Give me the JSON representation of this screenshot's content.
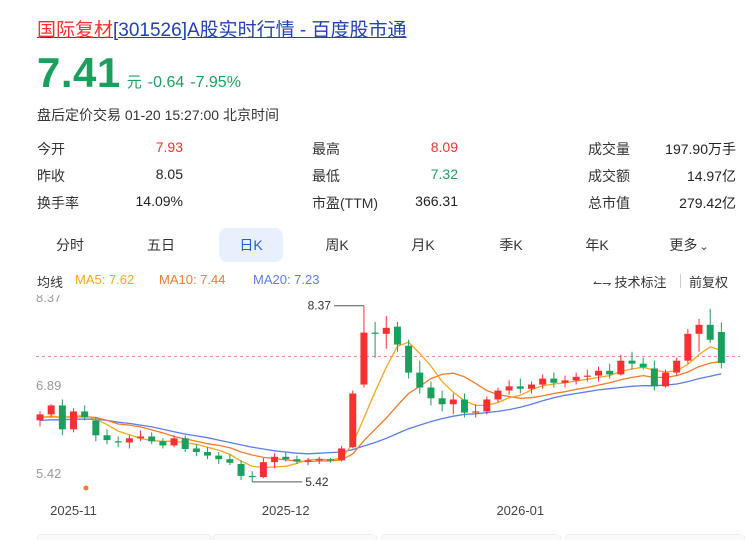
{
  "header": {
    "title_highlight": "国际复材",
    "title_rest": "[301526]A股实时行情 - 百度股市通"
  },
  "quote": {
    "price": "7.41",
    "unit": "元",
    "change": "-0.64",
    "change_pct": "-7.95%",
    "status_time": "盘后定价交易 01-20 15:27:00 北京时间"
  },
  "metrics": {
    "open_label": "今开",
    "open": "7.93",
    "prev_close_label": "昨收",
    "prev_close": "8.05",
    "turnover_label": "换手率",
    "turnover": "14.09%",
    "high_label": "最高",
    "high": "8.09",
    "low_label": "最低",
    "low": "7.32",
    "pe_label": "市盈(TTM)",
    "pe": "366.31",
    "volume_label": "成交量",
    "volume": "197.90万手",
    "amount_label": "成交额",
    "amount": "14.97亿",
    "mktcap_label": "总市值",
    "mktcap": "279.42亿"
  },
  "tabs": [
    {
      "label": "分时",
      "active": false
    },
    {
      "label": "五日",
      "active": false
    },
    {
      "label": "日K",
      "active": true
    },
    {
      "label": "周K",
      "active": false
    },
    {
      "label": "月K",
      "active": false
    },
    {
      "label": "季K",
      "active": false
    },
    {
      "label": "年K",
      "active": false
    },
    {
      "label": "更多",
      "active": false
    }
  ],
  "ma_legend": {
    "label": "均线",
    "ma5": "MA5: 7.62",
    "ma10": "MA10: 7.44",
    "ma20": "MA20: 7.23"
  },
  "tools": {
    "indicator": "技术标注",
    "adjust": "前复权"
  },
  "colors": {
    "up": "#f73131",
    "down": "#1a9f5c",
    "ma5": "#f5a623",
    "ma10": "#f07b2c",
    "ma20": "#5b7ee5",
    "active_tab_bg": "#e8f0fe",
    "active_tab_text": "#2a5bd7"
  },
  "chart_data": {
    "type": "candlestick",
    "y_ticks": [
      "8.37",
      "6.89",
      "5.42"
    ],
    "x_ticks": [
      {
        "label": "2025-11",
        "index": 3
      },
      {
        "label": "2025-12",
        "index": 22
      },
      {
        "label": "2026-01",
        "index": 43
      }
    ],
    "ylim": [
      5.2,
      8.55
    ],
    "reference_price": 7.52,
    "max_label": "8.37",
    "max_index": 29,
    "min_label": "5.42",
    "min_index": 19,
    "candles": [
      [
        6.45,
        6.6,
        6.35,
        6.55
      ],
      [
        6.55,
        6.72,
        6.5,
        6.7
      ],
      [
        6.7,
        6.8,
        6.2,
        6.3
      ],
      [
        6.3,
        6.65,
        6.25,
        6.6
      ],
      [
        6.6,
        6.7,
        6.45,
        6.5
      ],
      [
        6.45,
        6.5,
        6.1,
        6.2
      ],
      [
        6.2,
        6.3,
        6.05,
        6.12
      ],
      [
        6.1,
        6.18,
        6.0,
        6.08
      ],
      [
        6.08,
        6.2,
        5.98,
        6.15
      ],
      [
        6.15,
        6.28,
        6.1,
        6.18
      ],
      [
        6.18,
        6.25,
        6.05,
        6.1
      ],
      [
        6.1,
        6.15,
        5.98,
        6.03
      ],
      [
        6.03,
        6.2,
        6.0,
        6.15
      ],
      [
        6.15,
        6.2,
        5.92,
        5.97
      ],
      [
        5.98,
        6.05,
        5.85,
        5.92
      ],
      [
        5.92,
        6.0,
        5.8,
        5.86
      ],
      [
        5.86,
        5.92,
        5.72,
        5.8
      ],
      [
        5.8,
        5.88,
        5.7,
        5.74
      ],
      [
        5.72,
        5.78,
        5.45,
        5.52
      ],
      [
        5.52,
        5.6,
        5.42,
        5.5
      ],
      [
        5.5,
        5.82,
        5.48,
        5.75
      ],
      [
        5.75,
        5.9,
        5.65,
        5.84
      ],
      [
        5.84,
        5.92,
        5.76,
        5.8
      ],
      [
        5.8,
        5.86,
        5.72,
        5.76
      ],
      [
        5.76,
        5.82,
        5.7,
        5.78
      ],
      [
        5.78,
        5.84,
        5.72,
        5.8
      ],
      [
        5.8,
        5.82,
        5.74,
        5.78
      ],
      [
        5.78,
        6.02,
        5.76,
        5.98
      ],
      [
        6.0,
        6.95,
        5.98,
        6.9
      ],
      [
        7.05,
        8.37,
        7.0,
        7.92
      ],
      [
        7.92,
        8.1,
        7.5,
        7.9
      ],
      [
        7.9,
        8.2,
        7.65,
        8.0
      ],
      [
        8.02,
        8.1,
        7.6,
        7.72
      ],
      [
        7.7,
        7.8,
        7.15,
        7.25
      ],
      [
        7.25,
        7.45,
        6.9,
        7.0
      ],
      [
        7.0,
        7.1,
        6.7,
        6.82
      ],
      [
        6.82,
        6.95,
        6.6,
        6.72
      ],
      [
        6.72,
        6.9,
        6.55,
        6.8
      ],
      [
        6.8,
        6.9,
        6.5,
        6.58
      ],
      [
        6.58,
        6.72,
        6.5,
        6.6
      ],
      [
        6.6,
        6.85,
        6.55,
        6.8
      ],
      [
        6.8,
        7.0,
        6.75,
        6.95
      ],
      [
        6.95,
        7.12,
        6.88,
        7.02
      ],
      [
        7.02,
        7.15,
        6.9,
        6.98
      ],
      [
        6.98,
        7.1,
        6.9,
        7.05
      ],
      [
        7.05,
        7.22,
        6.98,
        7.15
      ],
      [
        7.15,
        7.25,
        7.0,
        7.08
      ],
      [
        7.08,
        7.2,
        7.0,
        7.12
      ],
      [
        7.12,
        7.25,
        7.05,
        7.18
      ],
      [
        7.18,
        7.3,
        7.1,
        7.2
      ],
      [
        7.2,
        7.35,
        7.1,
        7.28
      ],
      [
        7.28,
        7.4,
        7.15,
        7.22
      ],
      [
        7.22,
        7.55,
        7.2,
        7.45
      ],
      [
        7.45,
        7.6,
        7.3,
        7.4
      ],
      [
        7.4,
        7.5,
        7.3,
        7.34
      ],
      [
        7.32,
        7.45,
        6.95,
        7.02
      ],
      [
        7.02,
        7.3,
        7.0,
        7.25
      ],
      [
        7.25,
        7.5,
        7.2,
        7.45
      ],
      [
        7.45,
        7.98,
        7.4,
        7.9
      ],
      [
        7.9,
        8.15,
        7.6,
        8.05
      ],
      [
        8.05,
        8.32,
        7.75,
        7.8
      ],
      [
        7.93,
        8.09,
        7.32,
        7.41
      ]
    ],
    "ma5": [
      6.5,
      6.52,
      6.5,
      6.52,
      6.53,
      6.47,
      6.38,
      6.27,
      6.21,
      6.15,
      6.11,
      6.1,
      6.1,
      6.08,
      6.05,
      6.0,
      5.95,
      5.88,
      5.77,
      5.68,
      5.66,
      5.67,
      5.68,
      5.73,
      5.79,
      5.8,
      5.79,
      5.82,
      6.06,
      6.49,
      6.93,
      7.34,
      7.69,
      7.76,
      7.57,
      7.36,
      7.1,
      6.92,
      6.78,
      6.7,
      6.7,
      6.75,
      6.83,
      6.87,
      6.96,
      7.03,
      7.06,
      7.08,
      7.11,
      7.14,
      7.17,
      7.2,
      7.27,
      7.31,
      7.34,
      7.29,
      7.26,
      7.28,
      7.39,
      7.55,
      7.68,
      7.62
    ],
    "ma10": [
      6.5,
      6.51,
      6.5,
      6.51,
      6.51,
      6.5,
      6.45,
      6.39,
      6.37,
      6.34,
      6.29,
      6.24,
      6.18,
      6.14,
      6.1,
      6.06,
      6.03,
      5.99,
      5.92,
      5.87,
      5.83,
      5.81,
      5.79,
      5.77,
      5.76,
      5.77,
      5.77,
      5.79,
      5.89,
      6.11,
      6.3,
      6.49,
      6.7,
      6.9,
      7.02,
      7.15,
      7.22,
      7.24,
      7.18,
      7.07,
      6.95,
      6.88,
      6.85,
      6.82,
      6.83,
      6.86,
      6.9,
      6.93,
      6.97,
      7.0,
      7.04,
      7.08,
      7.13,
      7.17,
      7.2,
      7.17,
      7.17,
      7.2,
      7.26,
      7.35,
      7.41,
      7.44
    ],
    "ma20": [
      6.45,
      6.46,
      6.46,
      6.47,
      6.47,
      6.47,
      6.45,
      6.42,
      6.4,
      6.37,
      6.34,
      6.3,
      6.26,
      6.22,
      6.19,
      6.16,
      6.12,
      6.08,
      6.04,
      6.0,
      5.97,
      5.94,
      5.92,
      5.9,
      5.89,
      5.9,
      5.91,
      5.92,
      5.96,
      6.02,
      6.08,
      6.15,
      6.23,
      6.31,
      6.37,
      6.43,
      6.48,
      6.52,
      6.55,
      6.56,
      6.58,
      6.6,
      6.63,
      6.67,
      6.72,
      6.78,
      6.83,
      6.87,
      6.9,
      6.93,
      6.96,
      6.98,
      7.0,
      7.02,
      7.03,
      7.03,
      7.04,
      7.06,
      7.1,
      7.15,
      7.19,
      7.23
    ]
  }
}
